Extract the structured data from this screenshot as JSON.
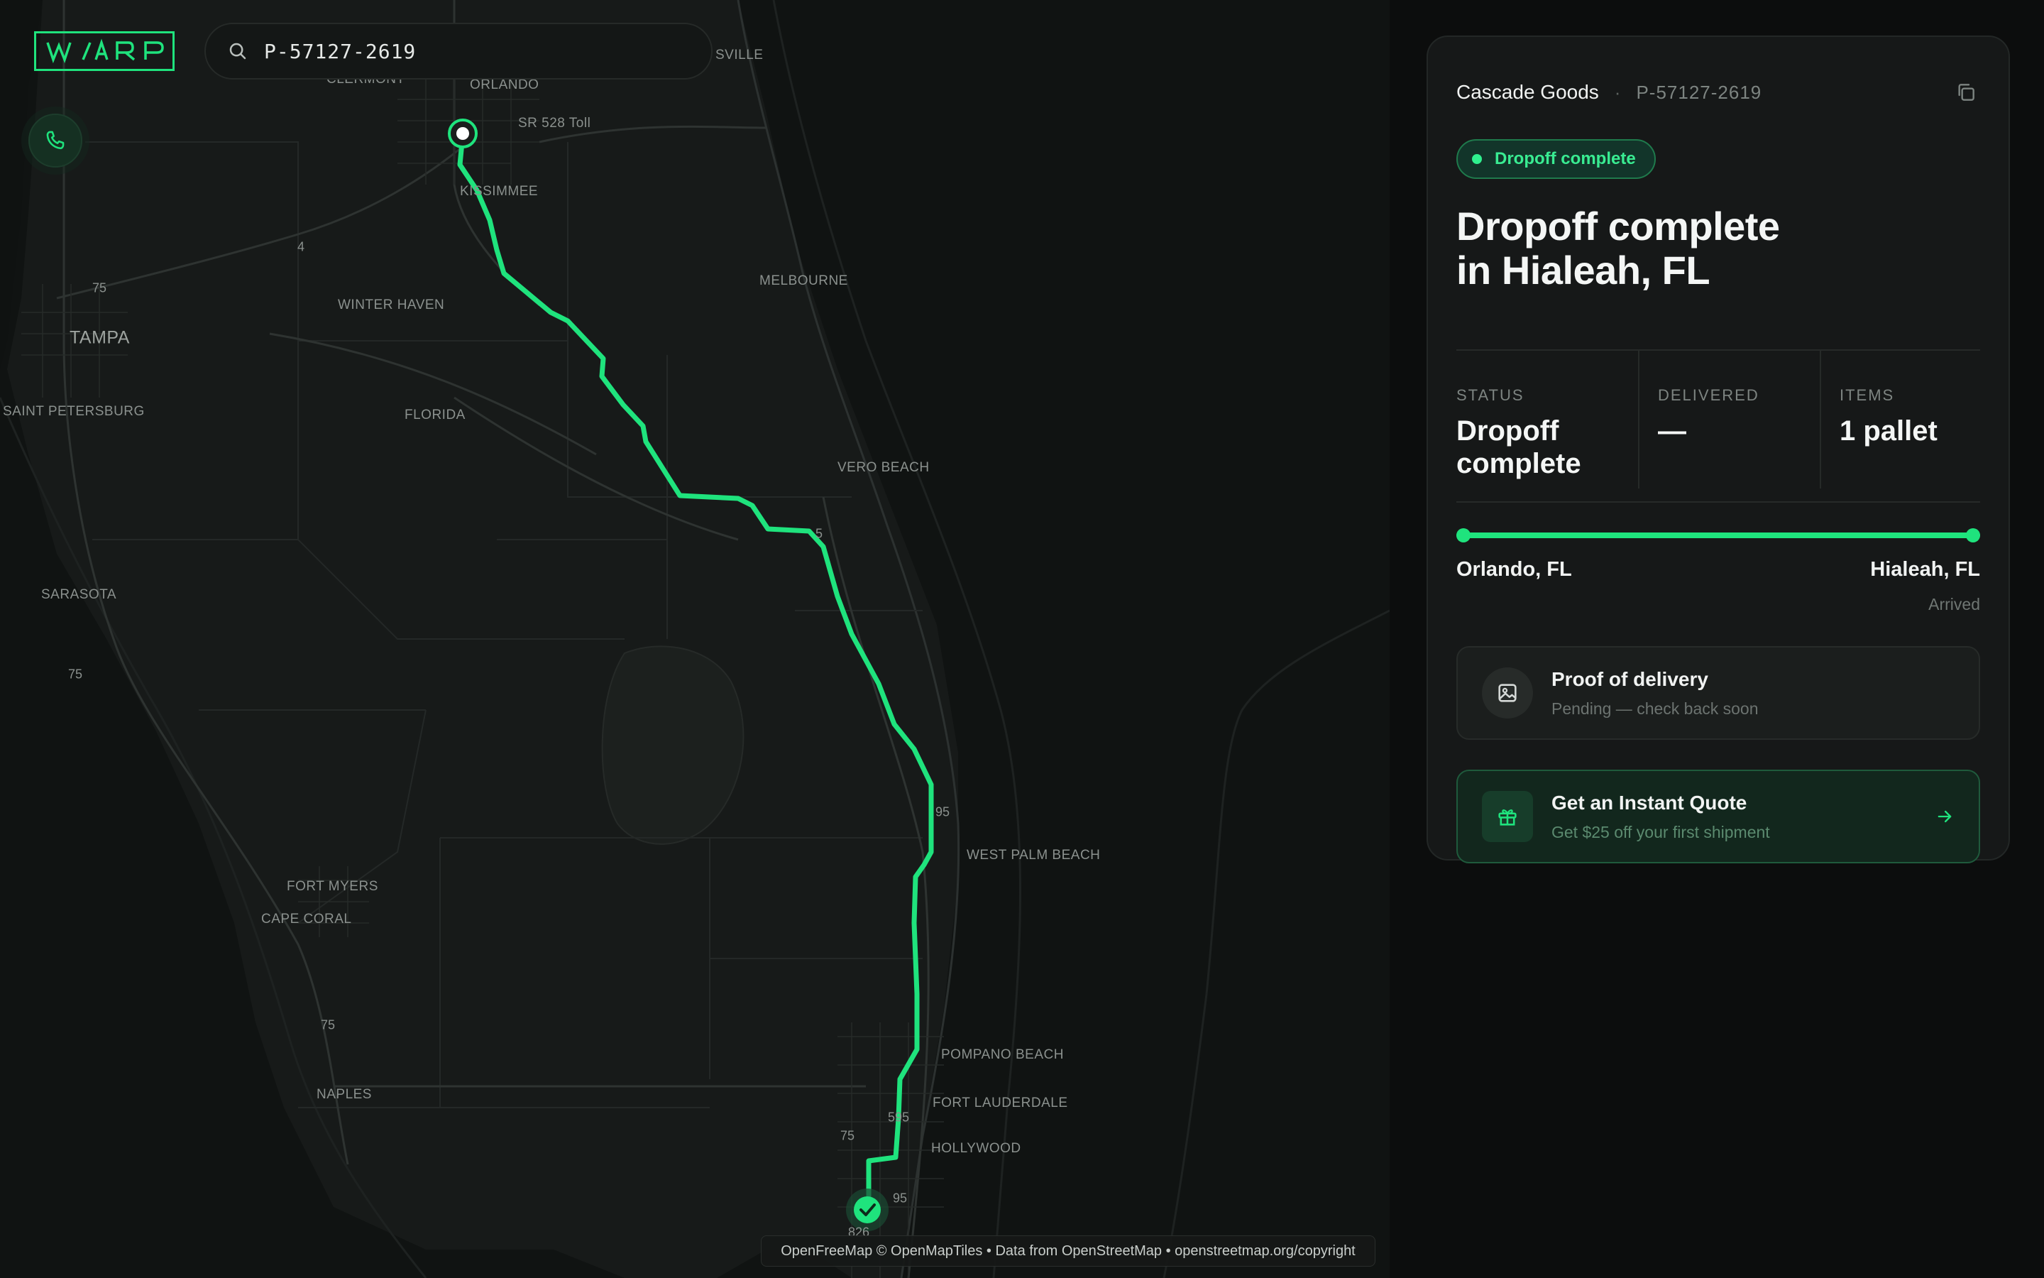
{
  "app": {
    "logo_text": "W/\\RP",
    "accent_color": "#1fe37d"
  },
  "search": {
    "value": "P-57127-2619",
    "icon": "search-icon"
  },
  "map": {
    "places": [
      {
        "name": "ORLANDO"
      },
      {
        "name": "CLERMONT"
      },
      {
        "name": "SVILLE"
      },
      {
        "name": "SR 528 Toll"
      },
      {
        "name": "KISSIMMEE"
      },
      {
        "name": "MELBOURNE"
      },
      {
        "name": "WINTER HAVEN"
      },
      {
        "name": "TAMPA"
      },
      {
        "name": "SAINT PETERSBURG"
      },
      {
        "name": "FLORIDA"
      },
      {
        "name": "VERO BEACH"
      },
      {
        "name": "SARASOTA"
      },
      {
        "name": "WEST PALM BEACH"
      },
      {
        "name": "FORT MYERS"
      },
      {
        "name": "CAPE CORAL"
      },
      {
        "name": "POMPANO BEACH"
      },
      {
        "name": "FORT LAUDERDALE"
      },
      {
        "name": "NAPLES"
      },
      {
        "name": "HOLLYWOOD"
      }
    ],
    "shields": [
      "75",
      "4",
      "75",
      "95",
      "75",
      "75",
      "595",
      "95",
      "826",
      "5"
    ],
    "attribution": "OpenFreeMap © OpenMapTiles • Data from OpenStreetMap • openstreetmap.org/copyright",
    "origin_marker": "origin-pin",
    "destination_marker": "check-icon"
  },
  "panel": {
    "shipper": "Cascade Goods",
    "separator": "·",
    "shipment_id": "P-57127-2619",
    "badge": "Dropoff complete",
    "headline_line1": "Dropoff complete",
    "headline_line2": "in Hialeah, FL",
    "stats": [
      {
        "label": "STATUS",
        "value_line1": "Dropoff",
        "value_line2": "complete"
      },
      {
        "label": "DELIVERED",
        "value_line1": "—",
        "value_line2": ""
      },
      {
        "label": "ITEMS",
        "value_line1": "1 pallet",
        "value_line2": ""
      }
    ],
    "progress": 1.0,
    "origin": "Orlando, FL",
    "destination": "Hialeah, FL",
    "destination_status": "Arrived",
    "proof_of_delivery": {
      "title": "Proof of delivery",
      "subtitle": "Pending — check back soon",
      "icon": "image-icon"
    },
    "quote": {
      "title": "Get an Instant Quote",
      "subtitle": "Get $25 off your first shipment",
      "icon": "gift-icon",
      "arrow_icon": "arrow-right-icon"
    }
  }
}
